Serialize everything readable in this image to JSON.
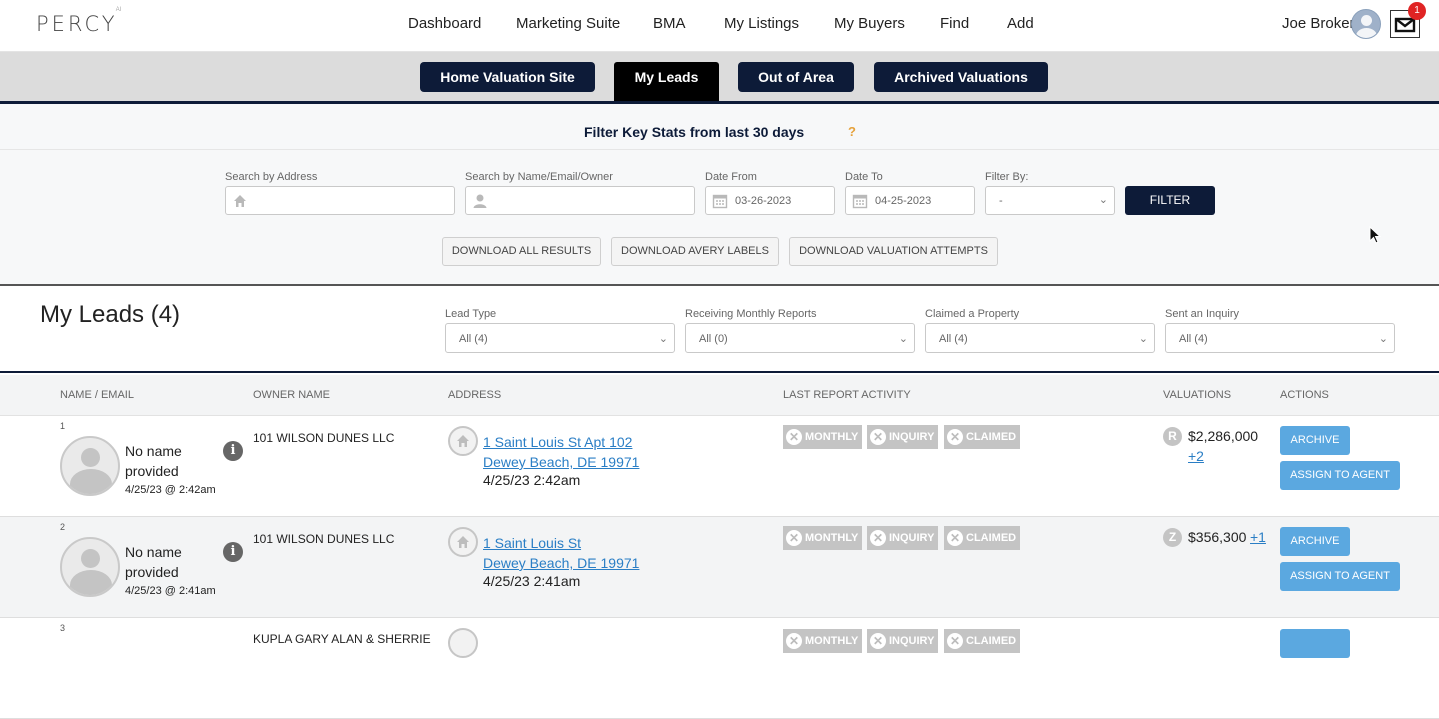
{
  "brand": {
    "logo_text": "PERCY",
    "logo_sup": "AI"
  },
  "nav": {
    "links": [
      "Dashboard",
      "Marketing Suite",
      "BMA",
      "My Listings",
      "My Buyers",
      "Find",
      "Add"
    ]
  },
  "user": {
    "name": "Joe Broker",
    "mail_count": "1"
  },
  "tabs": [
    "Home Valuation Site",
    "My Leads",
    "Out of Area",
    "Archived Valuations"
  ],
  "filter_header": {
    "title": "Filter Key Stats from last 30 days",
    "help": "?"
  },
  "search": {
    "address_label": "Search by Address",
    "name_label": "Search by Name/Email/Owner",
    "date_from_label": "Date From",
    "date_from": "03-26-2023",
    "date_to_label": "Date To",
    "date_to": "04-25-2023",
    "filter_by_label": "Filter By:",
    "filter_by_value": "-",
    "filter_button": "FILTER",
    "download_buttons": [
      "DOWNLOAD ALL RESULTS",
      "DOWNLOAD AVERY LABELS",
      "DOWNLOAD VALUATION ATTEMPTS"
    ]
  },
  "leads": {
    "title": "My Leads (4)",
    "filters": [
      {
        "label": "Lead Type",
        "value": "All (4)"
      },
      {
        "label": "Receiving Monthly Reports",
        "value": "All (0)"
      },
      {
        "label": "Claimed a Property",
        "value": "All (4)"
      },
      {
        "label": "Sent an Inquiry",
        "value": "All (4)"
      }
    ]
  },
  "table": {
    "headers": [
      "NAME / EMAIL",
      "OWNER NAME",
      "ADDRESS",
      "LAST REPORT ACTIVITY",
      "VALUATIONS",
      "ACTIONS"
    ],
    "activity_labels": [
      "MONTHLY",
      "INQUIRY",
      "CLAIMED"
    ],
    "archive_label": "ARCHIVE",
    "assign_label": "ASSIGN TO AGENT",
    "rows": [
      {
        "num": "1",
        "name_line1": "No name",
        "name_line2": "provided",
        "date": "4/25/23 @ 2:42am",
        "owner": "101 WILSON DUNES LLC",
        "address_line1": "1 Saint Louis St Apt 102",
        "address_line2": "Dewey Beach, DE 19971",
        "address_date": "4/25/23 2:42am",
        "valuation_badge": "R",
        "valuation": "$2,286,000",
        "valuation_more": "+2"
      },
      {
        "num": "2",
        "name_line1": "No name",
        "name_line2": "provided",
        "date": "4/25/23 @ 2:41am",
        "owner": "101 WILSON DUNES LLC",
        "address_line1": "1 Saint Louis St",
        "address_line2": "Dewey Beach, DE 19971",
        "address_date": "4/25/23 2:41am",
        "valuation_badge": "Z",
        "valuation": "$356,300",
        "valuation_more": "+1"
      },
      {
        "num": "3",
        "owner": "KUPLA GARY ALAN & SHERRIE"
      }
    ]
  }
}
